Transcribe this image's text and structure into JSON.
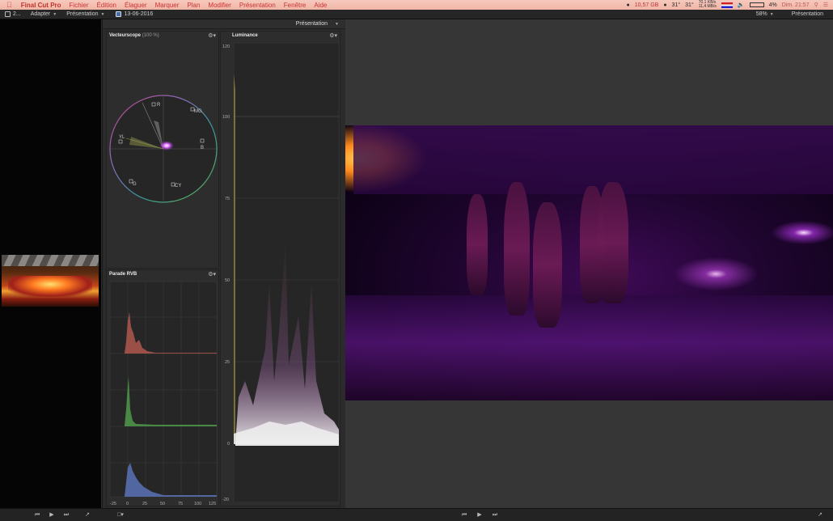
{
  "menubar": {
    "apple_icon": "apple-icon",
    "app_name": "Final Cut Pro",
    "items": [
      "Fichier",
      "Édition",
      "Élaguer",
      "Marquer",
      "Plan",
      "Modifier",
      "Présentation",
      "Fenêtre",
      "Aide"
    ],
    "status": {
      "disk": "10,57 GB",
      "temp": "31°",
      "temp2": "31°",
      "net_up": "70,1 KB/s",
      "net_down": "11,4 MB/s",
      "battery": "4%",
      "clock": "Dim. 21:57"
    }
  },
  "toolbar": {
    "library": "2...",
    "adapter": "Adapter",
    "presentation_left": "Présentation",
    "project": "13-06-2016",
    "zoom": "58%",
    "presentation_right": "Présentation"
  },
  "scopes": {
    "header_label": "Présentation",
    "vectorscope": {
      "title": "Vecteurscope",
      "subtitle": "(100 %)",
      "targets": [
        "R",
        "MG",
        "B",
        "CY",
        "G",
        "YL"
      ]
    },
    "parade": {
      "title": "Parade RVB",
      "x_ticks": [
        "-25",
        "0",
        "25",
        "50",
        "75",
        "100",
        "125"
      ]
    },
    "luminance": {
      "title": "Luminance",
      "y_ticks": [
        "120",
        "100",
        "75",
        "50",
        "25",
        "0",
        "-20"
      ]
    }
  },
  "colors": {
    "accent_red": "#c0342a",
    "parade_red": "#b85a50",
    "parade_green": "#4f9a4a",
    "parade_blue": "#5a72b8",
    "video_purple": "#5b1680"
  }
}
